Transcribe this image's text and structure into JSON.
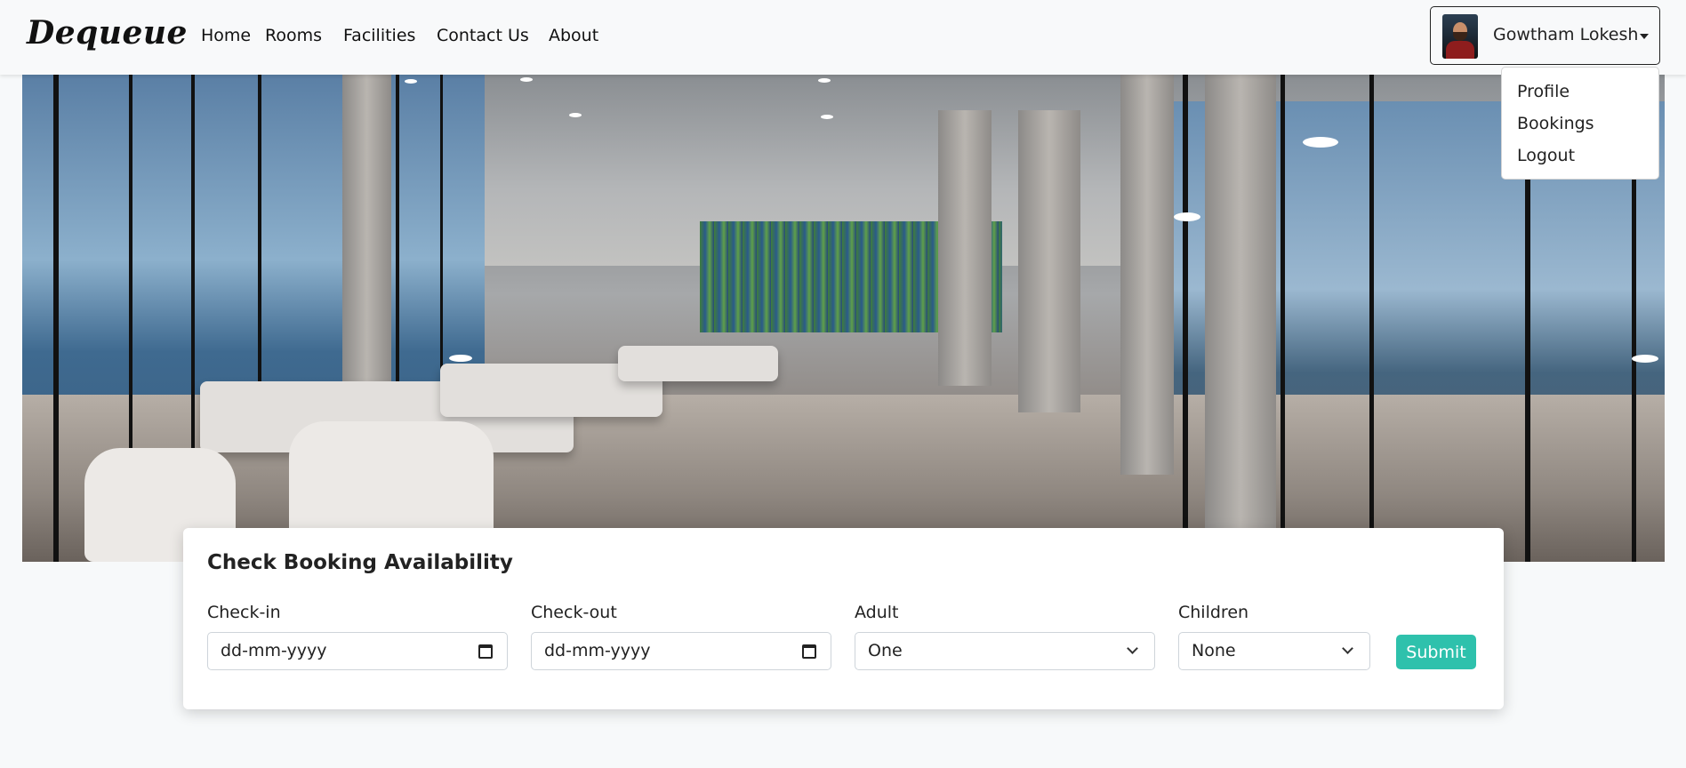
{
  "navbar": {
    "brand": "Dequeue",
    "links": [
      "Home",
      "Rooms",
      "Facilities",
      "Contact Us",
      "About"
    ]
  },
  "user_menu": {
    "name": "Gowtham Lokesh",
    "items": [
      "Profile",
      "Bookings",
      "Logout"
    ]
  },
  "booking": {
    "title": "Check Booking Availability",
    "checkin_label": "Check-in",
    "checkin_placeholder": "dd-mm-yyyy",
    "checkout_label": "Check-out",
    "checkout_placeholder": "dd-mm-yyyy",
    "adult_label": "Adult",
    "adult_value": "One",
    "children_label": "Children",
    "children_value": "None",
    "submit_label": "Submit"
  },
  "colors": {
    "accent": "#2ec1ac",
    "navbar_bg": "#f8f9fa",
    "page_bg": "#f7f9fa"
  }
}
